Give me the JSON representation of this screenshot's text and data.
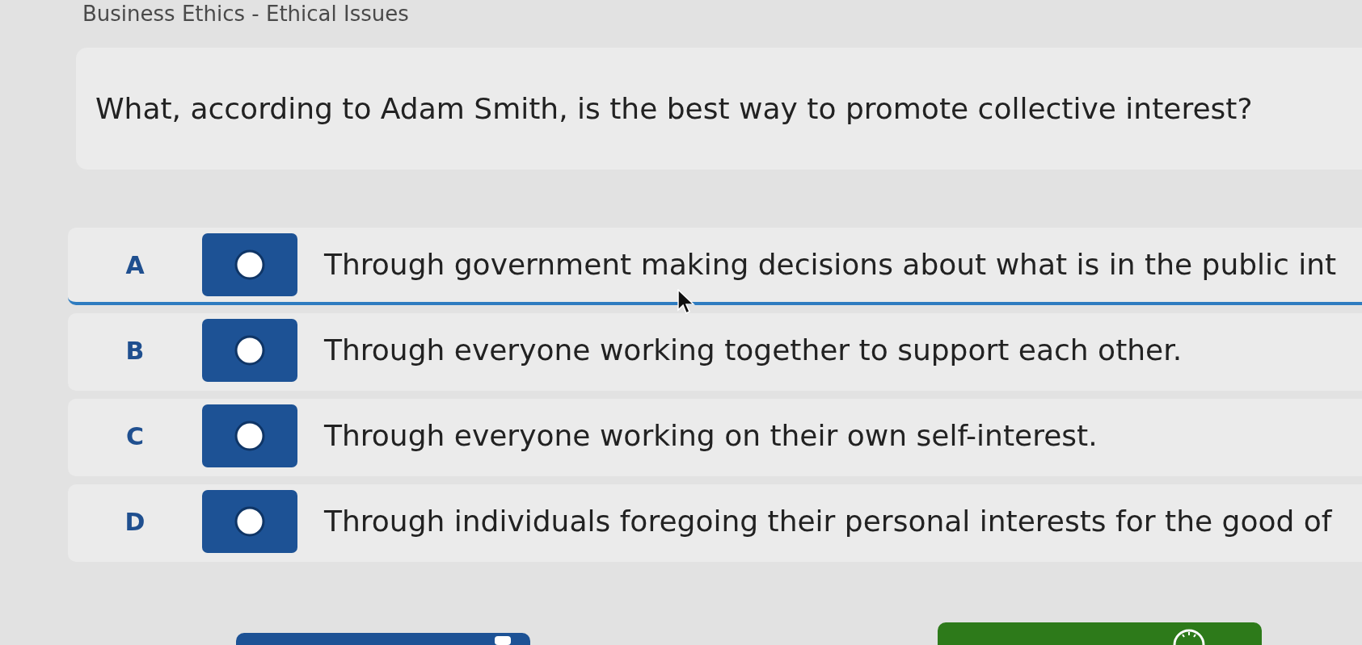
{
  "header": {
    "title": "Business Ethics - Ethical Issues"
  },
  "question": {
    "text": "What, according to Adam Smith, is the best way to promote collective interest?"
  },
  "options": [
    {
      "letter": "A",
      "text": "Through government making decisions about what is in the public int",
      "selected": false,
      "focused": true
    },
    {
      "letter": "B",
      "text": "Through everyone working together to support each other.",
      "selected": false,
      "focused": false
    },
    {
      "letter": "C",
      "text": "Through everyone working on their own self-interest.",
      "selected": false,
      "focused": false
    },
    {
      "letter": "D",
      "text": "Through individuals foregoing their personal interests for the good of",
      "selected": false,
      "focused": false
    }
  ],
  "footer": {
    "buttons": [
      {
        "kind": "primary"
      },
      {
        "kind": "success"
      }
    ]
  }
}
